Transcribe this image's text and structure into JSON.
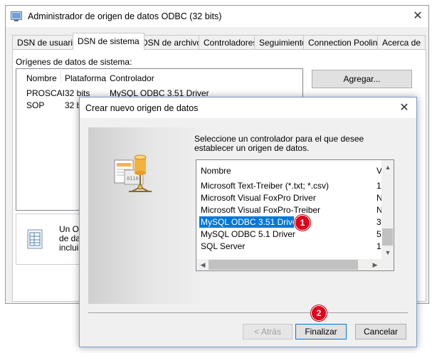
{
  "main_window": {
    "title": "Administrador de origen de datos ODBC (32 bits)",
    "close_glyph": "✕",
    "tabs": [
      {
        "label": "DSN de usuario"
      },
      {
        "label": "DSN de sistema"
      },
      {
        "label": "DSN de archivo"
      },
      {
        "label": "Controladores"
      },
      {
        "label": "Seguimiento"
      },
      {
        "label": "Connection Pooling"
      },
      {
        "label": "Acerca de"
      }
    ],
    "active_tab": "DSN de sistema",
    "sources_label": "Orígenes de datos de sistema:",
    "columns": [
      "Nombre",
      "Plataforma",
      "Controlador"
    ],
    "rows": [
      {
        "name": "PROSCAI",
        "platform": "32 bits",
        "driver": "MySQL ODBC 3.51 Driver"
      },
      {
        "name": "SOP",
        "platform": "32 b",
        "driver": ""
      }
    ],
    "add_button": "Agregar...",
    "info_lines": [
      "Un Or",
      "de dat",
      "incluic"
    ]
  },
  "dialog": {
    "title": "Crear nuevo origen de datos",
    "close_glyph": "✕",
    "instruction": "Seleccione un controlador para el que desee establecer un origen de datos.",
    "columns": {
      "name": "Nombre",
      "version": "V"
    },
    "drivers": [
      {
        "name": "Microsoft Text-Treiber (*.txt; *.csv)",
        "version": "1",
        "selected": false
      },
      {
        "name": "Microsoft Visual FoxPro Driver",
        "version": "N",
        "selected": false
      },
      {
        "name": "Microsoft Visual FoxPro-Treiber",
        "version": "N",
        "selected": false
      },
      {
        "name": "MySQL ODBC 3.51 Driver",
        "version": "3",
        "selected": true
      },
      {
        "name": "MySQL ODBC 5.1 Driver",
        "version": "5",
        "selected": false
      },
      {
        "name": "SQL Server",
        "version": "1",
        "selected": false
      }
    ],
    "back_button": "< Atrás",
    "finish_button": "Finalizar",
    "cancel_button": "Cancelar"
  },
  "annotations": {
    "step1": "1",
    "step2": "2",
    "badge_color": "#e3001b"
  },
  "icons": {
    "app": "odbc-admin-icon",
    "illustration": "database-wizard-icon",
    "info": "document-table-icon",
    "scroll_up": "▲",
    "scroll_down": "▼",
    "scroll_left": "◀",
    "scroll_right": "▶"
  },
  "colors": {
    "selection": "#0078d7",
    "button_face": "#e1e1e1"
  }
}
